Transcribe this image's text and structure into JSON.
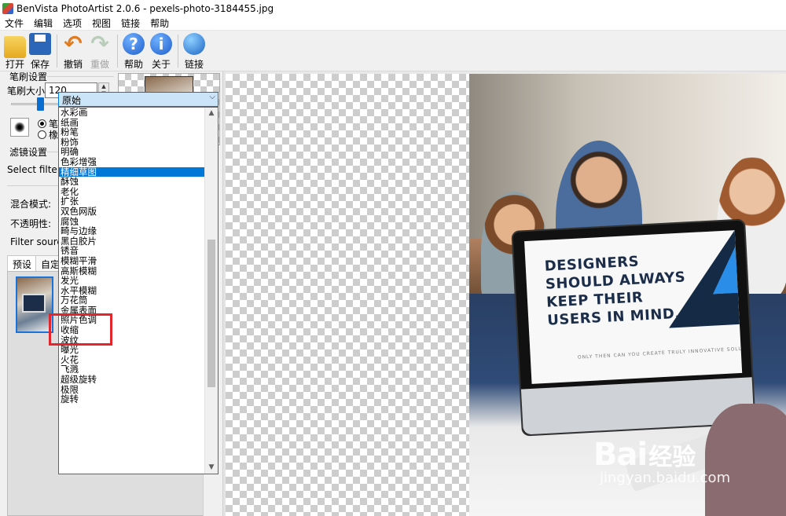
{
  "window": {
    "title": "BenVista PhotoArtist 2.0.6 - pexels-photo-3184455.jpg"
  },
  "menubar": {
    "items": [
      "文件",
      "编辑",
      "选项",
      "视图",
      "链接",
      "帮助"
    ]
  },
  "toolbar": {
    "open": "打开",
    "save": "保存",
    "undo": "撤销",
    "redo": "重做",
    "help": "帮助",
    "about": "关于",
    "link": "链接"
  },
  "brush": {
    "group_title": "笔刷设置",
    "size_label": "笔刷大小:",
    "size_value": "120",
    "size_slider_fraction": 0.28,
    "radio_brush": "笔刷",
    "radio_eraser": "橡皮擦",
    "selected": "笔刷"
  },
  "filter": {
    "group_title": "滤镜设置",
    "select_label": "Select filter:",
    "selected": "原始",
    "blend_label": "混合模式:",
    "opacity_label": "不透明性:",
    "source_label": "Filter source",
    "tabs": [
      "预设",
      "自定"
    ],
    "active_tab": "预设",
    "options": [
      "水彩画",
      "纸画",
      "粉笔",
      "粉饰",
      "明确",
      "色彩增强",
      "精细草图",
      "酥蚀",
      "老化",
      "扩张",
      "双色网版",
      "腐蚀",
      "畸与边缘",
      "黑白胶片",
      "锈音",
      "模糊平滑",
      "高斯模糊",
      "发光",
      "水平模糊",
      "万花筒",
      "金属表面",
      "照片色调",
      "收缩",
      "波纹",
      "曝光",
      "火花",
      "飞溅",
      "超级旋转",
      "极限",
      "旋转"
    ],
    "highlighted_option": "精细草图"
  },
  "photo": {
    "headline": "DESIGNERS SHOULD ALWAYS KEEP THEIR USERS IN MIND.",
    "tagline": "ONLY THEN CAN YOU CREATE TRULY INNOVATIVE SOLUTIONS"
  },
  "watermark": {
    "logo": "Bai",
    "logo2": "经验",
    "url": "jingyan.baidu.com"
  }
}
